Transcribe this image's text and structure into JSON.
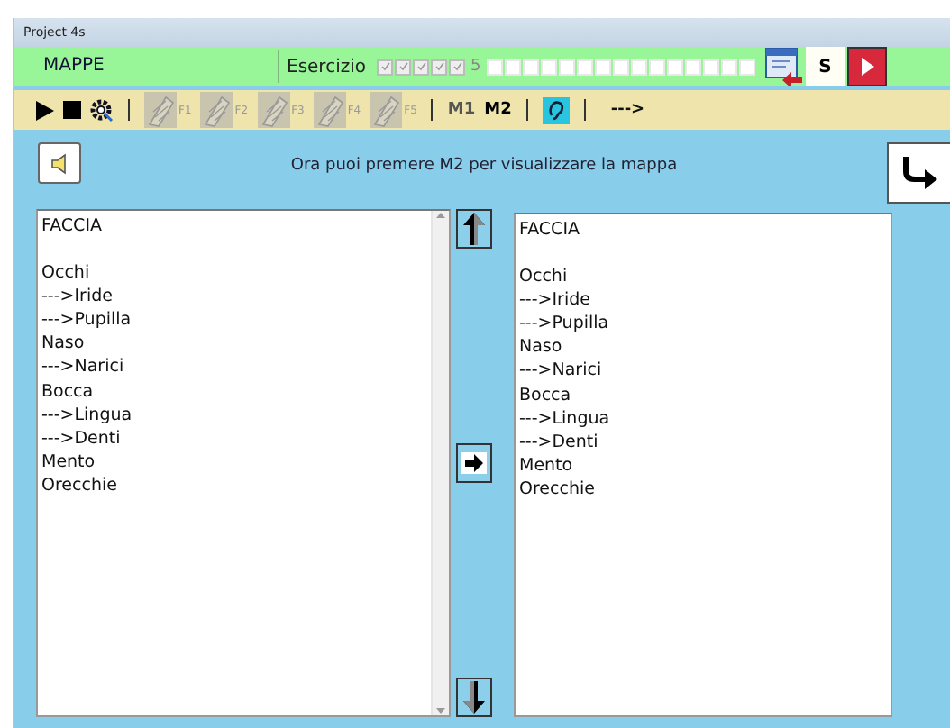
{
  "window": {
    "title": "Project 4s"
  },
  "header": {
    "module": "MAPPE",
    "exercise_label": "Esercizio",
    "steps": [
      {
        "checked": true
      },
      {
        "checked": true
      },
      {
        "checked": true
      },
      {
        "checked": true
      },
      {
        "checked": true
      },
      {
        "checked": false
      },
      {
        "checked": false
      },
      {
        "checked": false
      },
      {
        "checked": false
      },
      {
        "checked": false
      },
      {
        "checked": false
      },
      {
        "checked": false
      },
      {
        "checked": false
      },
      {
        "checked": false
      },
      {
        "checked": false
      },
      {
        "checked": false
      },
      {
        "checked": false
      },
      {
        "checked": false
      },
      {
        "checked": false
      },
      {
        "checked": false
      }
    ],
    "count": "5",
    "s_button": "S"
  },
  "toolbar": {
    "function_keys": [
      {
        "label": "F1",
        "disabled": true
      },
      {
        "label": "F2",
        "disabled": true
      },
      {
        "label": "F3",
        "disabled": true
      },
      {
        "label": "F4",
        "disabled": true
      },
      {
        "label": "F5",
        "disabled": true
      }
    ],
    "modes": [
      {
        "label": "M1",
        "selected": false
      },
      {
        "label": "M2",
        "selected": true
      }
    ],
    "next": "--->"
  },
  "message": "Ora puoi premere M2 per visualizzare la mappa",
  "source_text": [
    {
      "kind": "heading",
      "text": "FACCIA"
    },
    {
      "kind": "line",
      "text": "Occhi"
    },
    {
      "kind": "line",
      "text": "--->Iride"
    },
    {
      "kind": "line",
      "text": "--->Pupilla"
    },
    {
      "kind": "line",
      "text": "Naso"
    },
    {
      "kind": "line",
      "text": "--->Narici"
    },
    {
      "kind": "line",
      "text": "Bocca"
    },
    {
      "kind": "line",
      "text": "--->Lingua"
    },
    {
      "kind": "line",
      "text": "--->Denti"
    },
    {
      "kind": "line",
      "text": "Mento"
    },
    {
      "kind": "line",
      "text": "Orecchie"
    }
  ],
  "map_text": [
    {
      "kind": "heading",
      "text": "FACCIA"
    },
    {
      "kind": "line",
      "text": "Occhi"
    },
    {
      "kind": "line",
      "text": "--->Iride"
    },
    {
      "kind": "line",
      "text": "--->Pupilla"
    },
    {
      "kind": "line",
      "text": "Naso"
    },
    {
      "kind": "line",
      "text": "--->Narici"
    },
    {
      "kind": "line",
      "text": "Bocca"
    },
    {
      "kind": "line",
      "text": "--->Lingua"
    },
    {
      "kind": "line",
      "text": "--->Denti"
    },
    {
      "kind": "line",
      "text": "Mento"
    },
    {
      "kind": "line",
      "text": "Orecchie"
    }
  ]
}
